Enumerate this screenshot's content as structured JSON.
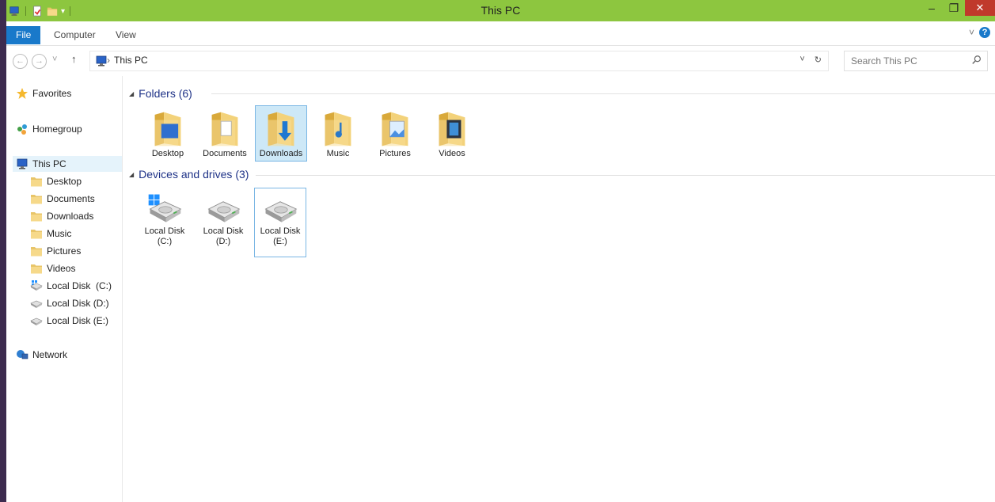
{
  "window": {
    "title": "This PC",
    "minimize": "–",
    "restore": "❐",
    "close": "✕"
  },
  "ribbon": {
    "tabs": [
      "File",
      "Computer",
      "View"
    ],
    "expand_glyph": "˅",
    "help_glyph": "?"
  },
  "address": {
    "back_glyph": "←",
    "forward_glyph": "→",
    "history_glyph": "˅",
    "up_glyph": "↑",
    "separator": "›",
    "location": "This PC",
    "dropdown_glyph": "˅",
    "refresh_glyph": "↻"
  },
  "search": {
    "placeholder": "Search This PC"
  },
  "navpane": {
    "favorites": "Favorites",
    "homegroup": "Homegroup",
    "this_pc": "This PC",
    "children": [
      "Desktop",
      "Documents",
      "Downloads",
      "Music",
      "Pictures",
      "Videos",
      "Local Disk  (C:)",
      "Local Disk (D:)",
      "Local Disk (E:)"
    ],
    "network": "Network"
  },
  "content": {
    "folders_header": "Folders (6)",
    "folders": [
      "Desktop",
      "Documents",
      "Downloads",
      "Music",
      "Pictures",
      "Videos"
    ],
    "drives_header": "Devices and drives (3)",
    "drives": [
      {
        "line1": "Local Disk",
        "line2": "(C:)"
      },
      {
        "line1": "Local Disk",
        "line2": "(D:)"
      },
      {
        "line1": "Local Disk",
        "line2": "(E:)"
      }
    ]
  },
  "colors": {
    "titlebar": "#8dc63f",
    "file_tab": "#1979ca",
    "close_button": "#c0392b",
    "group_header": "#1e3287",
    "selection": "#cde8f7"
  }
}
